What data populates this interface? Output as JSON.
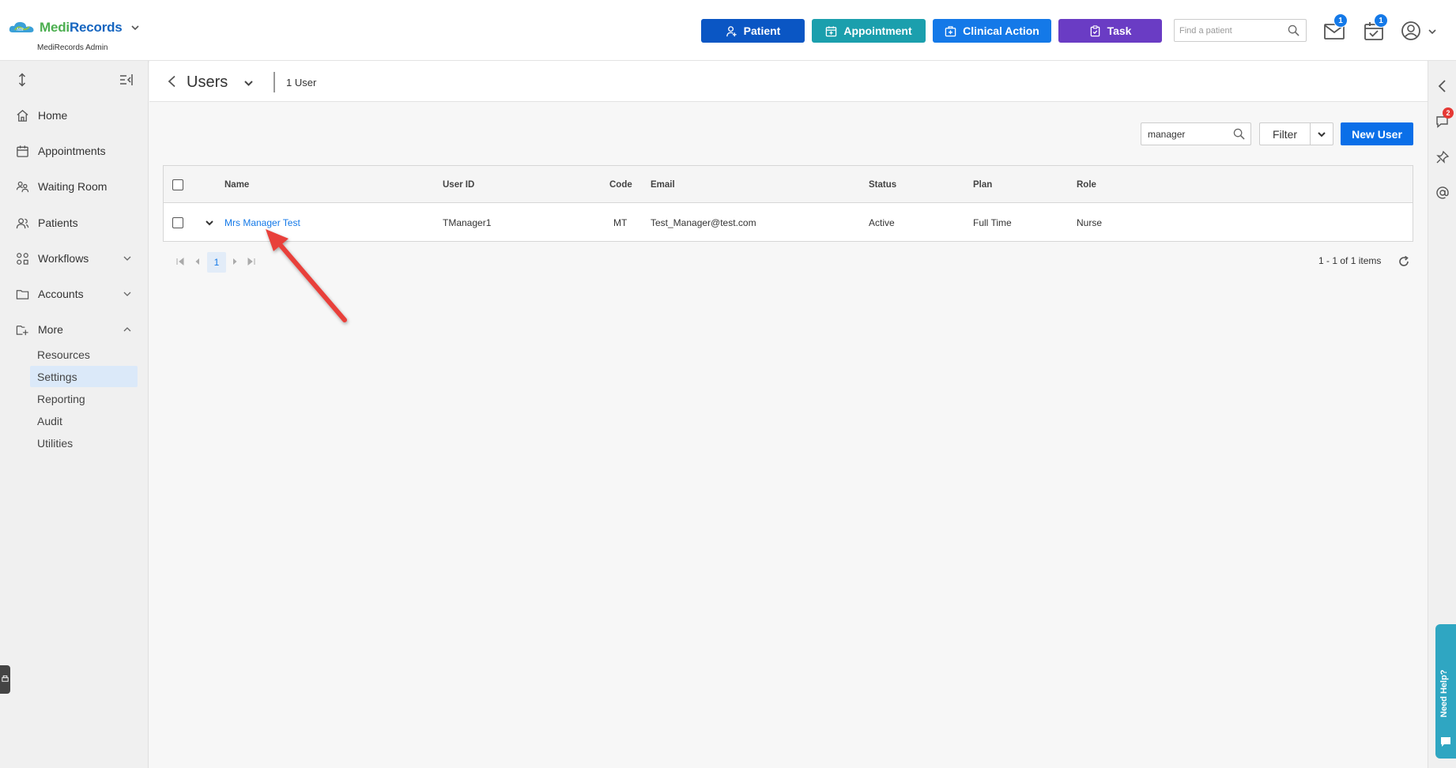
{
  "app": {
    "brand_part1": "Medi",
    "brand_part2": "Records",
    "subtitle": "MediRecords Admin"
  },
  "header": {
    "buttons": [
      {
        "label": "Patient",
        "color": "#0a56c4"
      },
      {
        "label": "Appointment",
        "color": "#1b9fad"
      },
      {
        "label": "Clinical Action",
        "color": "#1479e8"
      },
      {
        "label": "Task",
        "color": "#6a3cc4"
      }
    ],
    "find_placeholder": "Find a patient",
    "mail_badge": "1",
    "calendar_badge": "1"
  },
  "sidebar": {
    "items": [
      {
        "label": "Home",
        "icon": "home-icon"
      },
      {
        "label": "Appointments",
        "icon": "calendar-icon"
      },
      {
        "label": "Waiting Room",
        "icon": "waiting-room-icon"
      },
      {
        "label": "Patients",
        "icon": "patients-icon"
      },
      {
        "label": "Workflows",
        "icon": "workflows-icon"
      },
      {
        "label": "Accounts",
        "icon": "folder-icon"
      },
      {
        "label": "More",
        "icon": "folder-plus-icon"
      }
    ],
    "more_items": [
      "Resources",
      "Settings",
      "Reporting",
      "Audit",
      "Utilities"
    ],
    "active_item": "Settings"
  },
  "page": {
    "title": "Users",
    "count": "1 User",
    "search_value": "manager",
    "filter_label": "Filter",
    "new_button": "New User"
  },
  "table": {
    "columns": [
      "Name",
      "User ID",
      "Code",
      "Email",
      "Status",
      "Plan",
      "Role"
    ],
    "rows": [
      {
        "name": "Mrs Manager Test",
        "user_id": "TManager1",
        "code": "MT",
        "email": "Test_Manager@test.com",
        "status": "Active",
        "plan": "Full Time",
        "role": "Nurse"
      }
    ]
  },
  "pager": {
    "current_page": "1",
    "info": "1 - 1 of 1 items"
  },
  "rightrail": {
    "notification_badge": "2",
    "help_label": "Need Help?"
  },
  "colors": {
    "accent": "#1479e8",
    "annotation_arrow": "#e8403a"
  }
}
